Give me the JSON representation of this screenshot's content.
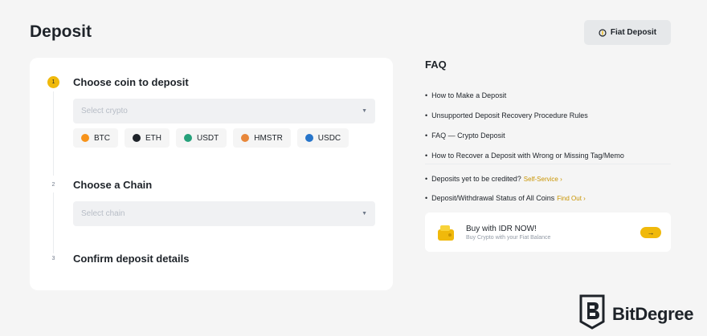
{
  "header": {
    "title": "Deposit",
    "fiat_button": "Fiat Deposit"
  },
  "steps": [
    {
      "number": "1",
      "title": "Choose coin to deposit",
      "placeholder": "Select crypto"
    },
    {
      "number": "2",
      "title": "Choose a Chain",
      "placeholder": "Select chain"
    },
    {
      "number": "3",
      "title": "Confirm deposit details"
    }
  ],
  "coins": [
    {
      "label": "BTC",
      "color": "#f7931a"
    },
    {
      "label": "ETH",
      "color": "#1e2329"
    },
    {
      "label": "USDT",
      "color": "#26a17b"
    },
    {
      "label": "HMSTR",
      "color": "#e8873a"
    },
    {
      "label": "USDC",
      "color": "#2775ca"
    }
  ],
  "faq": {
    "title": "FAQ",
    "items": [
      "How to Make a Deposit",
      "Unsupported Deposit Recovery Procedure Rules",
      "FAQ — Crypto Deposit",
      "How to Recover a Deposit with Wrong or Missing Tag/Memo"
    ],
    "status_rows": [
      {
        "text": "Deposits yet to be credited?",
        "link": "Self-Service"
      },
      {
        "text": "Deposit/Withdrawal Status of All Coins",
        "link": "Find Out"
      }
    ]
  },
  "promo": {
    "title": "Buy with IDR NOW!",
    "subtitle": "Buy Crypto with your Fiat Balance",
    "arrow": "→"
  },
  "watermark": {
    "text": "BitDegree"
  },
  "colors": {
    "accent": "#f0b90b",
    "link": "#c99400",
    "background": "#f5f5f5"
  },
  "icons": {
    "fiat": "coin-cycle-icon",
    "select": "caret-down-icon",
    "bullet": "bullet-dot",
    "watermark": "bitdegree-logo"
  }
}
